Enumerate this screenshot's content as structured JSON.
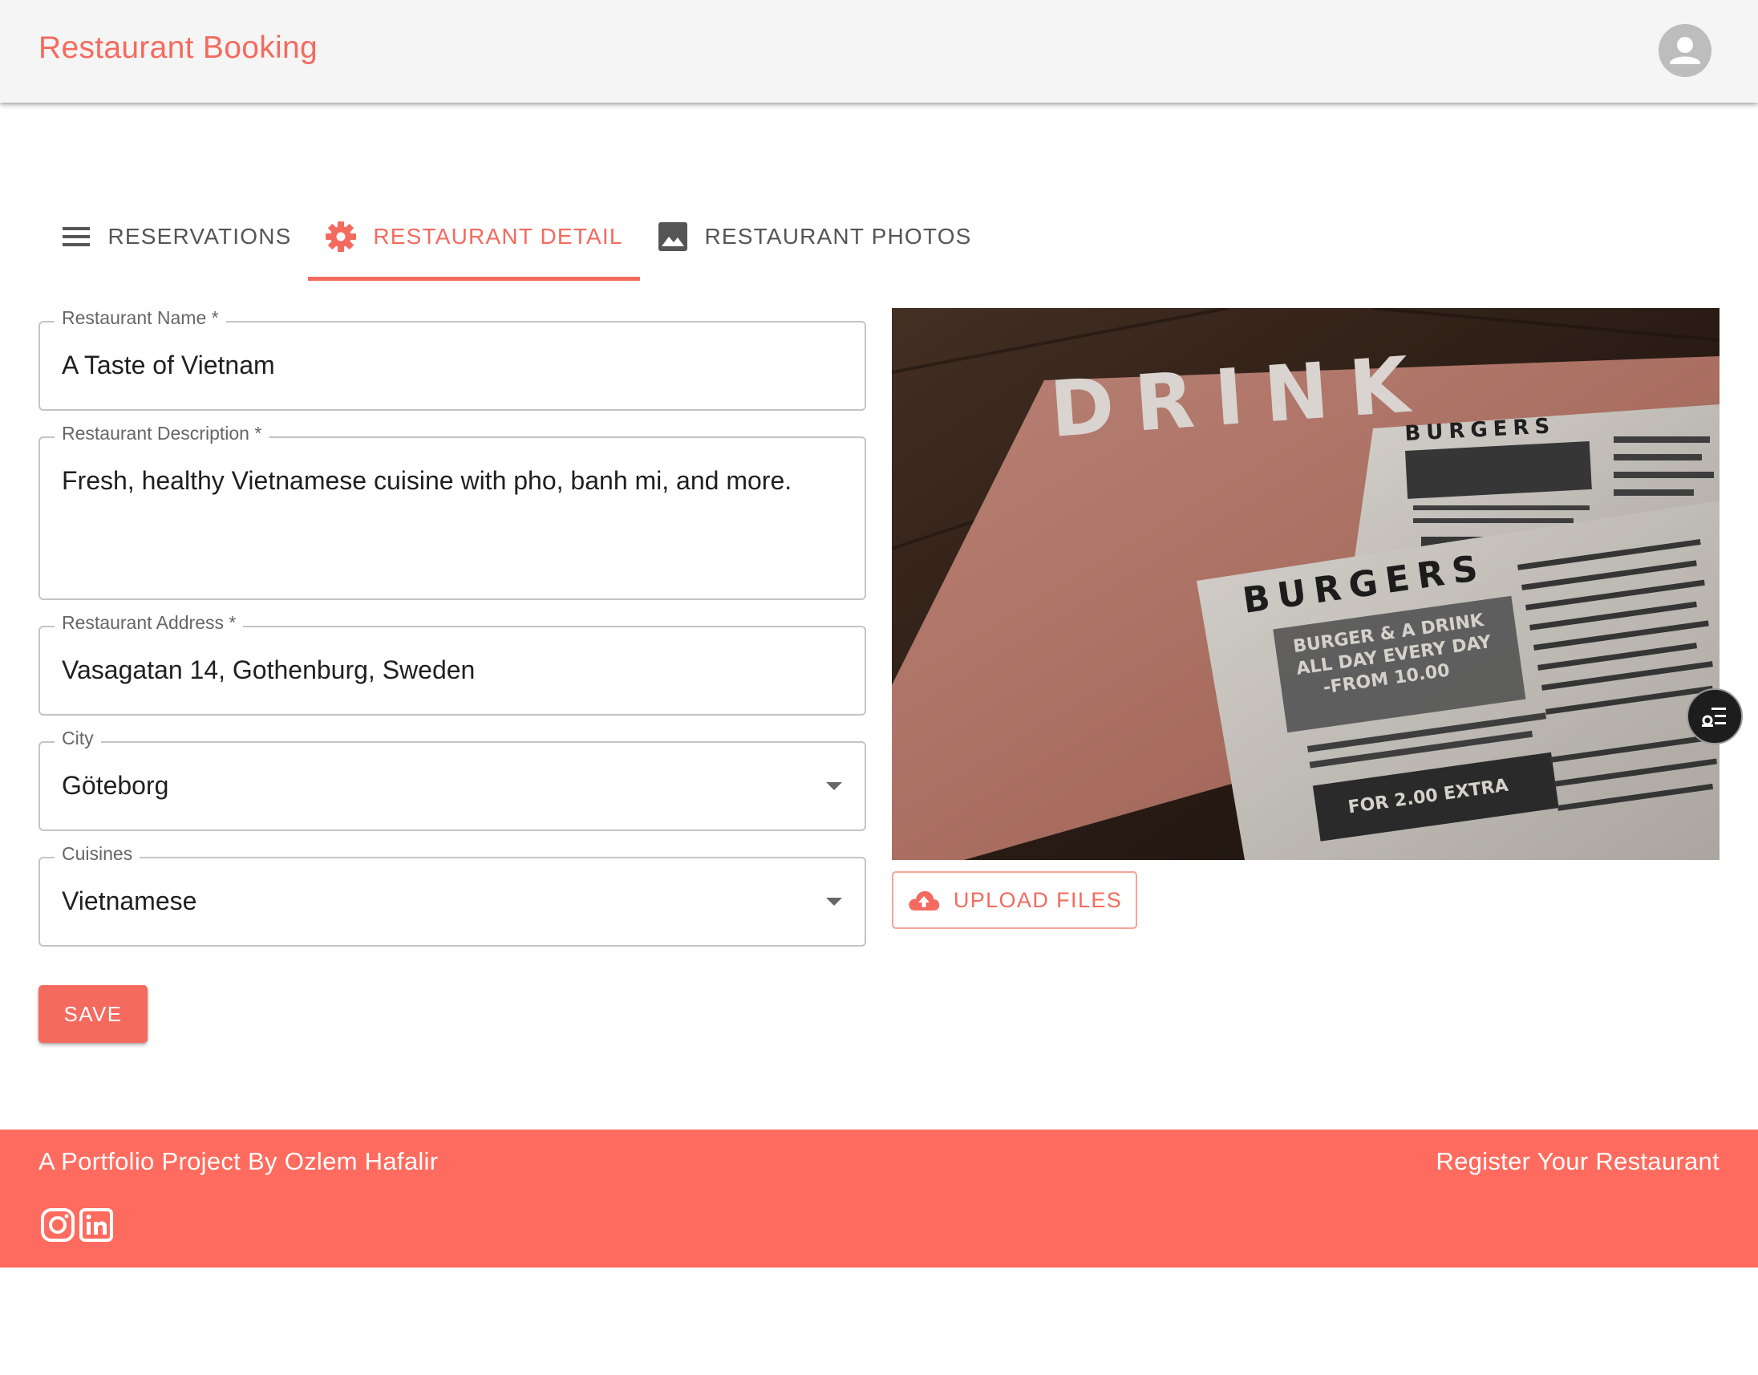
{
  "app": {
    "title": "Restaurant Booking",
    "accent_color": "#f56a5e"
  },
  "header": {
    "avatar_icon": "account-circle-icon"
  },
  "tabs": [
    {
      "label": "RESERVATIONS",
      "icon": "menu-icon",
      "active": false
    },
    {
      "label": "RESTAURANT DETAIL",
      "icon": "settings-gear-icon",
      "active": true
    },
    {
      "label": "RESTAURANT PHOTOS",
      "icon": "image-icon",
      "active": false
    }
  ],
  "form": {
    "name": {
      "label": "Restaurant Name *",
      "value": "A Taste of Vietnam"
    },
    "description": {
      "label": "Restaurant Description *",
      "value": "Fresh, healthy Vietnamese cuisine with pho, banh mi, and more."
    },
    "address": {
      "label": "Restaurant Address *",
      "value": "Vasagatan 14, Gothenburg, Sweden"
    },
    "city": {
      "label": "City",
      "value": "Göteborg"
    },
    "cuisines": {
      "label": "Cuisines",
      "value": "Vietnamese"
    },
    "save_label": "SAVE"
  },
  "photo": {
    "alt": "Menu photo",
    "menu_texts": {
      "drink": "DRINK",
      "burgers_back": "BURGERS",
      "burgers_front": "BURGERS",
      "promo_lines": [
        "BURGER & A DRINK",
        "ALL DAY EVERY DAY",
        "-FROM 10.00"
      ],
      "extra": "FOR 2.00 EXTRA"
    },
    "upload_label": "UPLOAD FILES",
    "upload_icon": "cloud-upload-icon"
  },
  "floating_button": {
    "icon": "list-settings-icon"
  },
  "footer": {
    "credit": "A Portfolio Project By Ozlem Hafalir",
    "register": "Register Your Restaurant",
    "social": [
      "instagram-icon",
      "linkedin-icon"
    ],
    "background_color": "#ff6b5e"
  }
}
